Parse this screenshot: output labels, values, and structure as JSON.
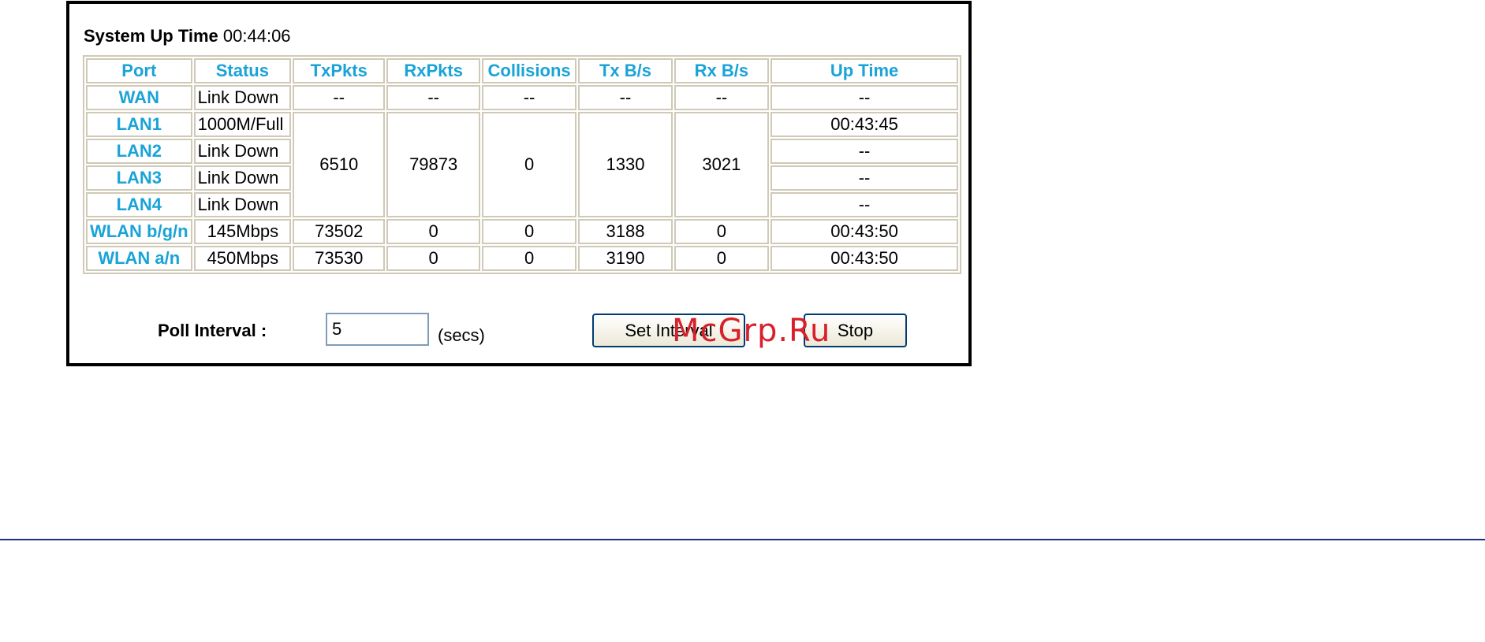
{
  "system_up_time": {
    "label": "System Up Time",
    "value": "00:44:06"
  },
  "table": {
    "headers": [
      "Port",
      "Status",
      "TxPkts",
      "RxPkts",
      "Collisions",
      "Tx B/s",
      "Rx B/s",
      "Up Time"
    ],
    "wan": {
      "port": "WAN",
      "status": "Link Down",
      "txpkts": "--",
      "rxpkts": "--",
      "collisions": "--",
      "txbs": "--",
      "rxbs": "--",
      "uptime": "--"
    },
    "lan_group": {
      "txpkts": "6510",
      "rxpkts": "79873",
      "collisions": "0",
      "txbs": "1330",
      "rxbs": "3021"
    },
    "lan_rows": [
      {
        "port": "LAN1",
        "status": "1000M/Full",
        "uptime": "00:43:45"
      },
      {
        "port": "LAN2",
        "status": "Link Down",
        "uptime": "--"
      },
      {
        "port": "LAN3",
        "status": "Link Down",
        "uptime": "--"
      },
      {
        "port": "LAN4",
        "status": "Link Down",
        "uptime": "--"
      }
    ],
    "wlan_rows": [
      {
        "port": "WLAN b/g/n",
        "status": "145Mbps",
        "txpkts": "73502",
        "rxpkts": "0",
        "collisions": "0",
        "txbs": "3188",
        "rxbs": "0",
        "uptime": "00:43:50"
      },
      {
        "port": "WLAN a/n",
        "status": "450Mbps",
        "txpkts": "73530",
        "rxpkts": "0",
        "collisions": "0",
        "txbs": "3190",
        "rxbs": "0",
        "uptime": "00:43:50"
      }
    ]
  },
  "poll": {
    "label": "Poll Interval :",
    "value": "5",
    "unit": "(secs)"
  },
  "buttons": {
    "set_interval": "Set Interval",
    "stop": "Stop"
  },
  "watermark": "McGrp.Ru"
}
